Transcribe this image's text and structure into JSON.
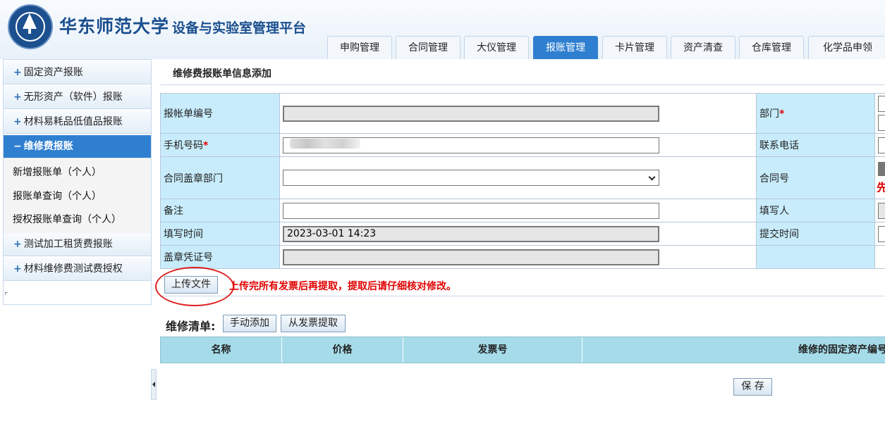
{
  "header": {
    "university": "华东师范大学",
    "platform": "设备与实验室管理平台",
    "tabs": [
      {
        "label": "申购管理",
        "active": false
      },
      {
        "label": "合同管理",
        "active": false
      },
      {
        "label": "大仪管理",
        "active": false
      },
      {
        "label": "报账管理",
        "active": true
      },
      {
        "label": "卡片管理",
        "active": false
      },
      {
        "label": "资产清查",
        "active": false
      },
      {
        "label": "仓库管理",
        "active": false
      },
      {
        "label": "化学品申领",
        "active": false
      }
    ]
  },
  "sidebar": {
    "items": [
      {
        "icon": "plus",
        "label": "固定资产报账"
      },
      {
        "icon": "plus",
        "label": "无形资产（软件）报账"
      },
      {
        "icon": "plus",
        "label": "材料易耗品低值品报账"
      },
      {
        "icon": "minus",
        "label": "维修费报账",
        "active": true
      },
      {
        "icon": "plus",
        "label": "测试加工租赁费报账"
      },
      {
        "icon": "plus",
        "label": "材料维修费测试费授权"
      }
    ],
    "sub_items": [
      "新增报账单（个人）",
      "报账单查询（个人）",
      "授权报账单查询（个人）"
    ]
  },
  "page": {
    "title": "维修费报账单信息添加",
    "form": {
      "bill_no_label": "报帐单编号",
      "dept_label": "部门",
      "phone_label": "手机号码",
      "contact_label": "联系电话",
      "seal_dept_label": "合同盖章部门",
      "contract_no_label": "合同号",
      "remark_label": "备注",
      "filler_label": "填写人",
      "fill_time_label": "填写时间",
      "fill_time_value": "2023-03-01 14:23",
      "submit_time_label": "提交时间",
      "seal_cert_label": "盖章凭证号",
      "required_mark": "*"
    },
    "upload_button": "上传文件",
    "upload_note": "上传完所有发票后再提取，提取后请仔细核对修改。",
    "repair_list_label": "维修清单:",
    "manual_add_button": "手动添加",
    "extract_button": "从发票提取",
    "columns": [
      "名称",
      "价格",
      "发票号",
      "维修的固定资产编号"
    ],
    "save_button": "保 存"
  },
  "colors": {
    "accent": "#2f7fd0",
    "label_bg": "#c8ecfb",
    "grid_header": "#a6dcea",
    "warning": "#e00000"
  }
}
